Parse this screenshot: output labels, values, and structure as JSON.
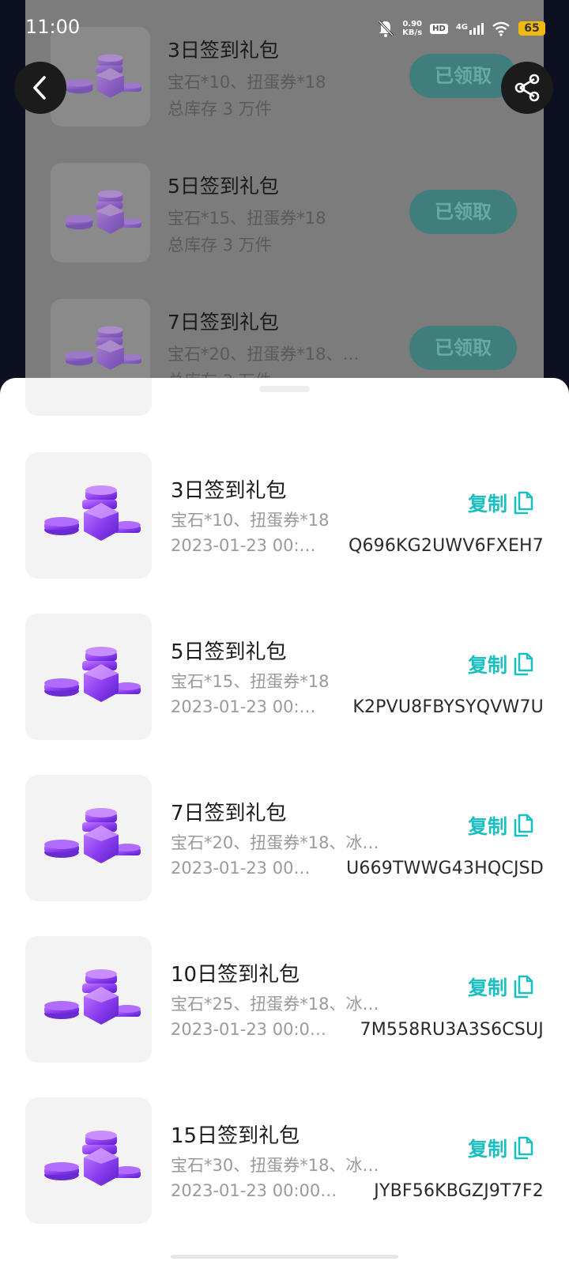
{
  "status_bar": {
    "time": "11:00",
    "net_speed_value": "0.90",
    "net_speed_unit": "KB/s",
    "hd_badge": "HD",
    "network": "4G",
    "battery": "65",
    "icons": [
      "mute-bell-icon",
      "signal-icon",
      "wifi-icon",
      "battery-icon"
    ]
  },
  "nav": {
    "back_icon": "chevron-left-icon",
    "share_icon": "share-icon"
  },
  "background_list": [
    {
      "title": "3日签到礼包",
      "desc": "宝石*10、扭蛋券*18",
      "stock": "总库存 3 万件",
      "button": "已领取"
    },
    {
      "title": "5日签到礼包",
      "desc": "宝石*15、扭蛋券*18",
      "stock": "总库存 3 万件",
      "button": "已领取"
    },
    {
      "title": "7日签到礼包",
      "desc": "宝石*20、扭蛋券*18、…",
      "stock": "总库存 3 万件",
      "button": "已领取"
    }
  ],
  "sheet": {
    "copy_label": "复制",
    "copy_icon": "copy-icon",
    "items": [
      {
        "title": "3日签到礼包",
        "desc": "宝石*10、扭蛋券*18",
        "date": "2023-01-23 00:…",
        "code": "Q696KG2UWV6FXEH7"
      },
      {
        "title": "5日签到礼包",
        "desc": "宝石*15、扭蛋券*18",
        "date": "2023-01-23 00:…",
        "code": "K2PVU8FBYSYQVW7U"
      },
      {
        "title": "7日签到礼包",
        "desc": "宝石*20、扭蛋券*18、冰…",
        "date": "2023-01-23 00…",
        "code": "U669TWWG43HQCJSD"
      },
      {
        "title": "10日签到礼包",
        "desc": "宝石*25、扭蛋券*18、冰…",
        "date": "2023-01-23 00:0…",
        "code": "7M558RU3A3S6CSUJ"
      },
      {
        "title": "15日签到礼包",
        "desc": "宝石*30、扭蛋券*18、冰…",
        "date": "2023-01-23 00:00…",
        "code": "JYBF56KBGZJ9T7F2"
      }
    ]
  },
  "colors": {
    "accent": "#1bbfc0",
    "gem": "#8a3df0"
  }
}
